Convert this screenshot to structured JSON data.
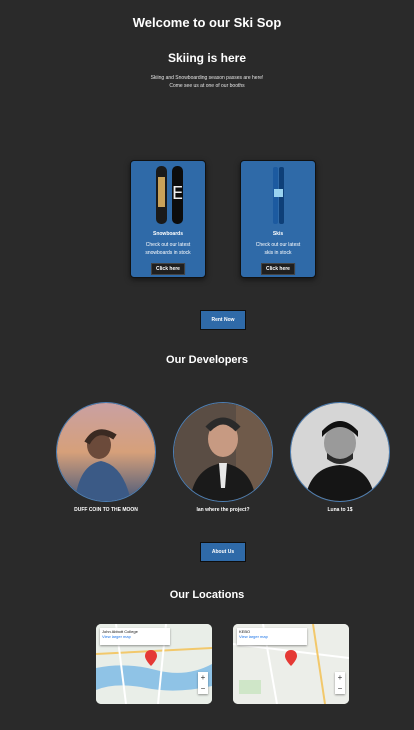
{
  "header": {
    "title": "Welcome to our Ski Sop",
    "subtitle": "Skiing is here",
    "intro_line1": "Skiing and Snowboarding season passes are here!",
    "intro_line2": "Come see us at one of our booths"
  },
  "products": [
    {
      "title": "Snowboards",
      "desc1": "Check out our latest",
      "desc2": "snowboards in stock",
      "button": "Click here"
    },
    {
      "title": "Skis",
      "desc1": "Check out our latest",
      "desc2": "skis in stock",
      "button": "Click here"
    }
  ],
  "rent_button": "Rent Now",
  "developers": {
    "heading": "Our Developers",
    "people": [
      {
        "caption": "DUFF COIN TO THE MOON"
      },
      {
        "caption": "Ian where the project?"
      },
      {
        "caption": "Luna to 1$"
      }
    ]
  },
  "about_button": "About Us",
  "locations": {
    "heading": "Our Locations",
    "maps": [
      {
        "name": "John Abbott College",
        "view_link": "View larger map",
        "zoom_in": "+",
        "zoom_out": "−",
        "pin_label": "John Abbott College"
      },
      {
        "name": "KEBO",
        "view_link": "View larger map",
        "zoom_in": "+",
        "zoom_out": "−",
        "pin_label": "KEBO"
      }
    ]
  },
  "colors": {
    "background": "#2a2a2a",
    "accent": "#2f6aa8"
  }
}
